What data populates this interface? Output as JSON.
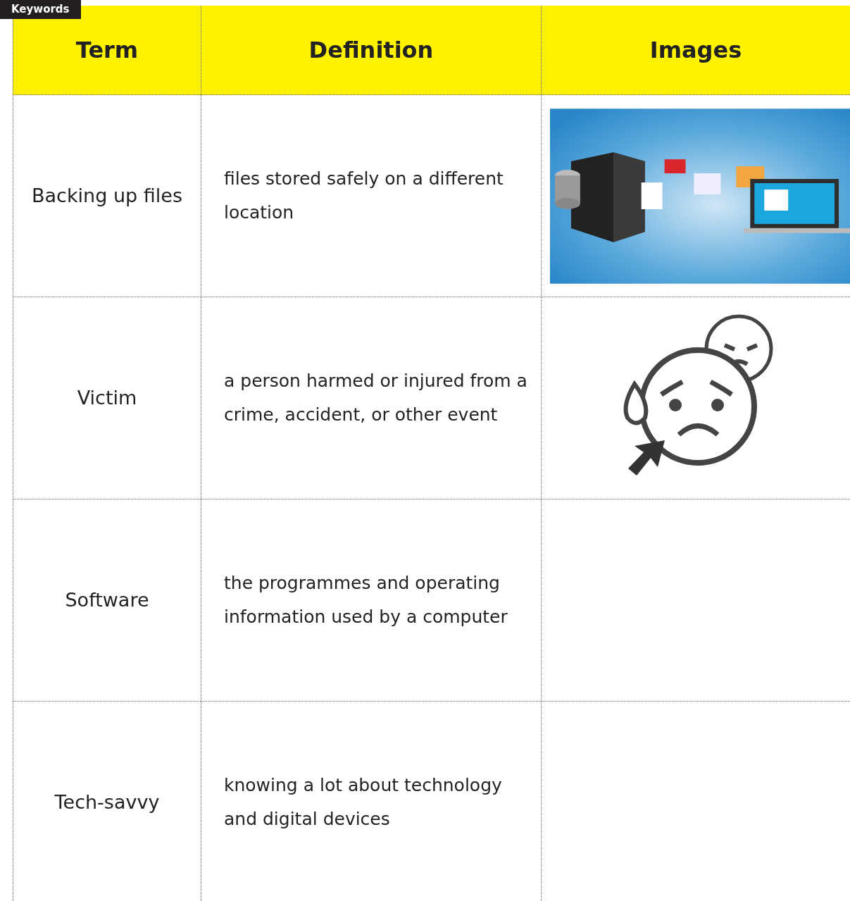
{
  "section_label": "Keywords",
  "table": {
    "columns": [
      "Term",
      "Definition",
      "Images"
    ],
    "rows": [
      {
        "term": "Backing up files",
        "definition": "files stored safely on a different location",
        "kind": "backup"
      },
      {
        "term": "Victim",
        "definition": "a person harmed or injured from a crime, accident, or other event",
        "kind": "victim"
      },
      {
        "term": "Software",
        "definition": "the programmes and operating information used by a computer",
        "kind": "empty"
      },
      {
        "term": "Tech-savvy",
        "definition": "knowing a lot about technology and digital devices",
        "kind": "empty"
      }
    ]
  }
}
